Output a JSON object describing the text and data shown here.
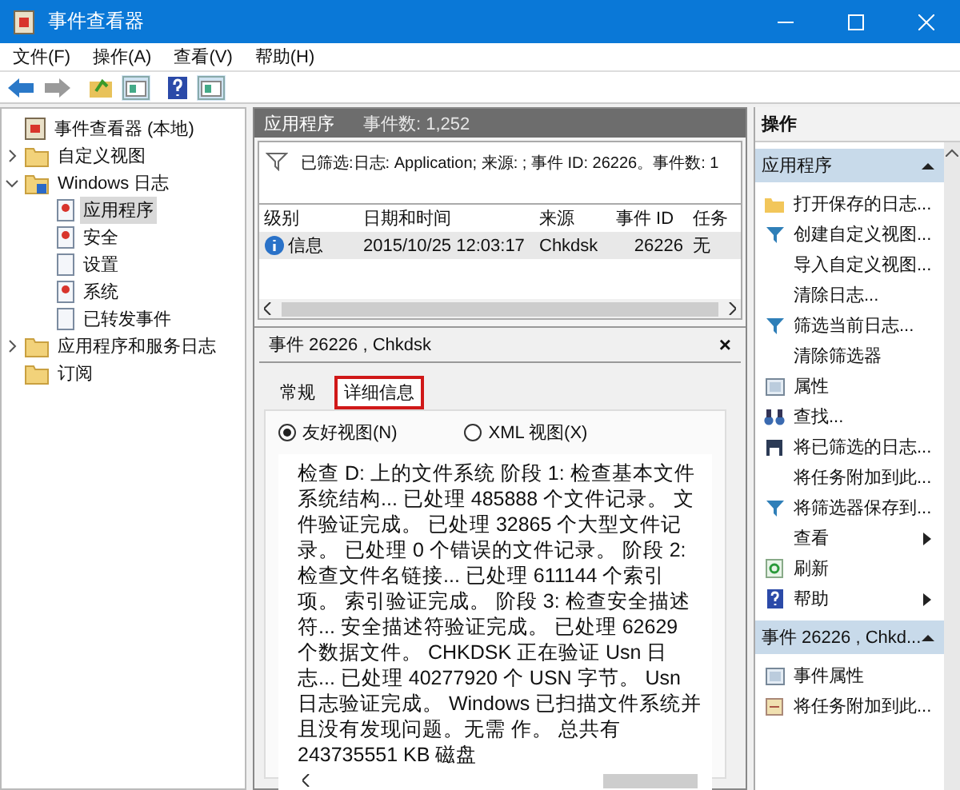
{
  "window": {
    "title": "事件查看器"
  },
  "menu": [
    "文件(F)",
    "操作(A)",
    "查看(V)",
    "帮助(H)"
  ],
  "toolbar": [
    {
      "kind": "back",
      "disabled": false
    },
    {
      "kind": "forward",
      "disabled": true
    },
    {
      "kind": "up",
      "disabled": false
    },
    {
      "kind": "pane",
      "disabled": false
    },
    {
      "kind": "help",
      "disabled": false
    },
    {
      "kind": "pane",
      "disabled": false
    }
  ],
  "tree": [
    {
      "label": "事件查看器 (本地)",
      "kind": "viewer",
      "selected": false,
      "children": [
        {
          "label": "自定义视图",
          "kind": "folder",
          "expanded": false,
          "selected": false
        },
        {
          "label": "Windows 日志",
          "kind": "logfolder",
          "expanded": true,
          "selected": false,
          "children": [
            {
              "label": "应用程序",
              "kind": "log",
              "selected": true
            },
            {
              "label": "安全",
              "kind": "log",
              "selected": false
            },
            {
              "label": "设置",
              "kind": "page",
              "selected": false
            },
            {
              "label": "系统",
              "kind": "log",
              "selected": false
            },
            {
              "label": "已转发事件",
              "kind": "page",
              "selected": false
            }
          ]
        },
        {
          "label": "应用程序和服务日志",
          "kind": "folder",
          "expanded": false,
          "selected": false
        },
        {
          "label": "订阅",
          "kind": "folder",
          "selected": false
        }
      ]
    }
  ],
  "log_header": {
    "name": "应用程序",
    "count": "事件数: 1,252"
  },
  "filter_text": "已筛选:日志: Application; 来源: ; 事件 ID: 26226。事件数: 1",
  "table": {
    "columns": [
      "级别",
      "日期和时间",
      "来源",
      "事件 ID",
      "任务"
    ],
    "rows": [
      {
        "level": "信息",
        "datetime": "2015/10/25 12:03:17",
        "source": "Chkdsk",
        "event_id": "26226",
        "task": "无",
        "selected": true
      }
    ]
  },
  "details": {
    "title": "事件 26226 , Chkdsk",
    "close": "×",
    "tabs": [
      {
        "label": "常规",
        "selected": false,
        "highlighted": false
      },
      {
        "label": "详细信息",
        "selected": true,
        "highlighted": true
      }
    ],
    "views": [
      {
        "label": "友好视图(N)",
        "selected": true
      },
      {
        "label": "XML 视图(X)",
        "selected": false
      }
    ],
    "message": "检查 D: 上的文件系统 阶段 1: 检查基本文件系统结构... 已处理 485888 个文件记录。 文件验证完成。 已处理 32865 个大型文件记录。 已处理 0 个错误的文件记录。 阶段 2: 检查文件名链接... 已处理 611144 个索引项。 索引验证完成。 阶段 3: 检查安全描述符... 安全描述符验证完成。 已处理 62629 个数据文件。 CHKDSK 正在验证 Usn 日志... 已处理 40277920 个 USN 字节。 Usn 日志验证完成。 Windows 已扫描文件系统并且没有发现问题。无需 作。 总共有 243735551 KB 磁盘"
  },
  "actions": {
    "title": "操作",
    "sections": [
      {
        "title": "应用程序",
        "expanded": true,
        "items": [
          {
            "label": "打开保存的日志...",
            "kind": "folder",
            "submenu": false
          },
          {
            "label": "创建自定义视图...",
            "kind": "filter",
            "submenu": false
          },
          {
            "label": "导入自定义视图...",
            "kind": "plain",
            "submenu": false
          },
          {
            "label": "清除日志...",
            "kind": "plain",
            "submenu": false
          },
          {
            "label": "筛选当前日志...",
            "kind": "filter",
            "submenu": false
          },
          {
            "label": "清除筛选器",
            "kind": "plain",
            "submenu": false
          },
          {
            "label": "属性",
            "kind": "props",
            "submenu": false
          },
          {
            "label": "查找...",
            "kind": "find",
            "submenu": false
          },
          {
            "label": "将已筛选的日志...",
            "kind": "save",
            "submenu": false
          },
          {
            "label": "将任务附加到此...",
            "kind": "plain",
            "submenu": false
          },
          {
            "label": "将筛选器保存到...",
            "kind": "filter",
            "submenu": false
          },
          {
            "label": "查看",
            "kind": "plain",
            "submenu": true
          },
          {
            "label": "刷新",
            "kind": "refresh",
            "submenu": false
          },
          {
            "label": "帮助",
            "kind": "help",
            "submenu": true
          }
        ]
      },
      {
        "title": "事件 26226 , Chkd...",
        "expanded": true,
        "items": [
          {
            "label": "事件属性",
            "kind": "props",
            "submenu": false
          },
          {
            "label": "将任务附加到此...",
            "kind": "task",
            "submenu": false
          }
        ]
      }
    ]
  }
}
